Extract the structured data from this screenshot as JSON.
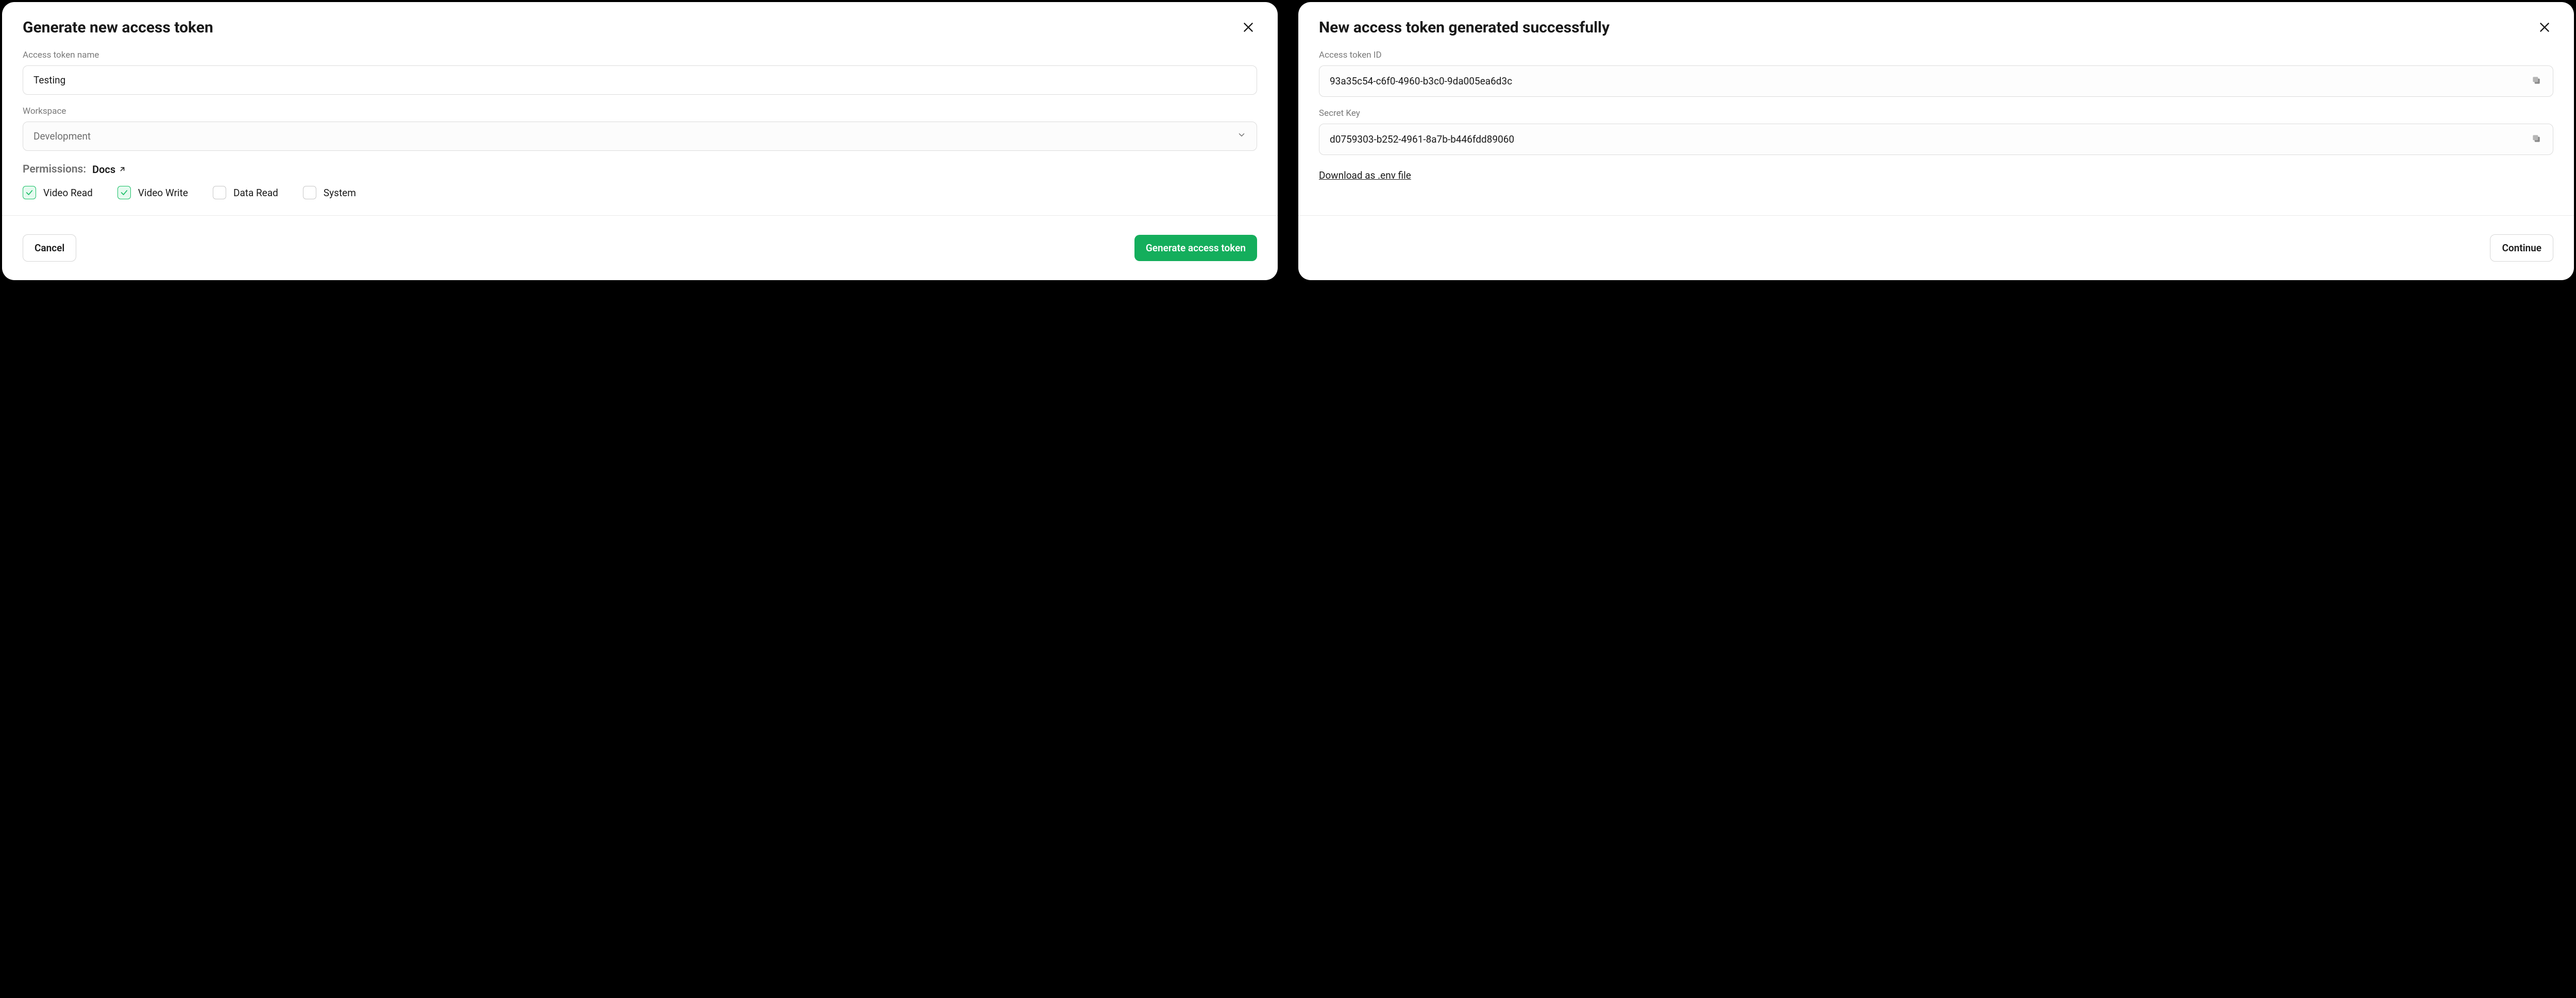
{
  "generate_modal": {
    "title": "Generate new access token",
    "name_label": "Access token name",
    "name_value": "Testing",
    "workspace_label": "Workspace",
    "workspace_value": "Development",
    "permissions_label": "Permissions:",
    "docs_label": "Docs",
    "checkboxes": [
      {
        "label": "Video Read",
        "checked": true
      },
      {
        "label": "Video Write",
        "checked": true
      },
      {
        "label": "Data Read",
        "checked": false
      },
      {
        "label": "System",
        "checked": false
      }
    ],
    "cancel_label": "Cancel",
    "submit_label": "Generate access token"
  },
  "success_modal": {
    "title": "New access token generated successfully",
    "id_label": "Access token ID",
    "id_value": "93a35c54-c6f0-4960-b3c0-9da005ea6d3c",
    "secret_label": "Secret Key",
    "secret_value": "d0759303-b252-4961-8a7b-b446fdd89060",
    "download_label": "Download as .env file",
    "continue_label": "Continue"
  }
}
